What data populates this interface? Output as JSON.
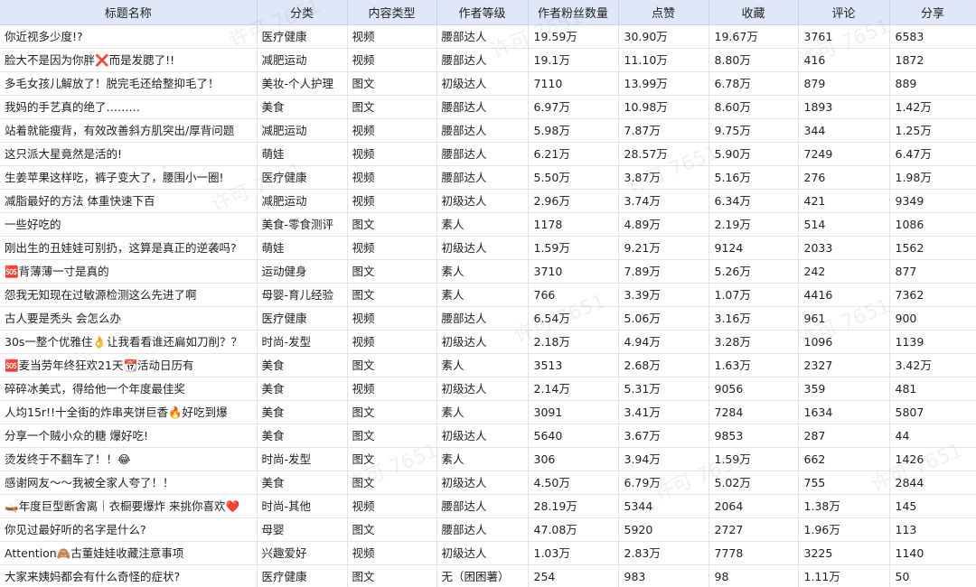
{
  "columns": [
    "标题名称",
    "分类",
    "内容类型",
    "作者等级",
    "作者粉丝数量",
    "点赞",
    "收藏",
    "评论",
    "分享"
  ],
  "rows": [
    [
      "你近视多少度!?",
      "医疗健康",
      "视频",
      "腰部达人",
      "19.59万",
      "30.90万",
      "19.67万",
      "3761",
      "6583"
    ],
    [
      "脸大不是因为你胖❌而是发腮了!!",
      "减肥运动",
      "视频",
      "腰部达人",
      "19.1万",
      "11.10万",
      "8.80万",
      "416",
      "1872"
    ],
    [
      "多毛女孩儿解放了！脱完毛还给整抑毛了！",
      "美妆-个人护理",
      "图文",
      "初级达人",
      "7110",
      "13.99万",
      "6.78万",
      "879",
      "889"
    ],
    [
      "我妈的手艺真的绝了………",
      "美食",
      "图文",
      "腰部达人",
      "6.97万",
      "10.98万",
      "8.60万",
      "1893",
      "1.42万"
    ],
    [
      "站着就能瘦背，有效改善斜方肌突出/厚背问题",
      "减肥运动",
      "视频",
      "腰部达人",
      "5.98万",
      "7.87万",
      "9.75万",
      "344",
      "1.25万"
    ],
    [
      "这只派大星竟然是活的!",
      "萌娃",
      "视频",
      "腰部达人",
      "6.21万",
      "28.57万",
      "5.90万",
      "7249",
      "6.47万"
    ],
    [
      "生姜苹果这样吃，裤子变大了，腰围小一圈!",
      "医疗健康",
      "视频",
      "腰部达人",
      "5.50万",
      "3.87万",
      "5.16万",
      "276",
      "1.98万"
    ],
    [
      "减脂最好的方法 体重快速下百",
      "减肥运动",
      "视频",
      "初级达人",
      "2.96万",
      "3.74万",
      "6.34万",
      "421",
      "9349"
    ],
    [
      "一些好吃的",
      "美食-零食测评",
      "图文",
      "素人",
      "1178",
      "4.89万",
      "2.19万",
      "514",
      "1086"
    ],
    [
      "刚出生的丑娃娃可别扔，这算是真正的逆袭吗?",
      "萌娃",
      "视频",
      "初级达人",
      "1.59万",
      "9.21万",
      "9124",
      "2033",
      "1562"
    ],
    [
      "🆘背薄薄一寸是真的",
      "运动健身",
      "图文",
      "素人",
      "3710",
      "7.89万",
      "5.26万",
      "242",
      "877"
    ],
    [
      "怨我无知现在过敏源检测这么先进了啊",
      "母婴-育儿经验",
      "图文",
      "素人",
      "766",
      "3.39万",
      "1.07万",
      "4416",
      "7362"
    ],
    [
      "古人要是秃头 会怎么办",
      "医疗健康",
      "视频",
      "腰部达人",
      "6.54万",
      "5.06万",
      "3.16万",
      "961",
      "900"
    ],
    [
      "30s一整个优雅住👌让我看看谁还扁如刀削？？",
      "时尚-发型",
      "视频",
      "初级达人",
      "2.18万",
      "4.94万",
      "3.28万",
      "1096",
      "1139"
    ],
    [
      "🆘麦当劳年终狂欢21天📆活动日历有",
      "美食",
      "图文",
      "素人",
      "3513",
      "2.68万",
      "1.63万",
      "2327",
      "3.42万"
    ],
    [
      "碎碎冰美式，得给他一个年度最佳奖",
      "美食",
      "视频",
      "初级达人",
      "2.14万",
      "5.31万",
      "9056",
      "359",
      "481"
    ],
    [
      "人均15r!!十全街的炸串夹饼巨香🔥好吃到爆",
      "美食",
      "图文",
      "素人",
      "3091",
      "3.41万",
      "7284",
      "1634",
      "5807"
    ],
    [
      "分享一个贼小众的糖 爆好吃!",
      "美食",
      "图文",
      "初级达人",
      "5640",
      "3.67万",
      "9853",
      "287",
      "44"
    ],
    [
      "烫发终于不翻车了！！😂",
      "时尚-发型",
      "图文",
      "素人",
      "306",
      "3.94万",
      "1.59万",
      "662",
      "1426"
    ],
    [
      "感谢网友～～我被全家人夸了！！",
      "美食",
      "图文",
      "初级达人",
      "4.50万",
      "6.79万",
      "5.02万",
      "755",
      "2844"
    ],
    [
      "🛶年度巨型断舍离｜衣橱要爆炸 来挑你喜欢❤️",
      "时尚-其他",
      "视频",
      "腰部达人",
      "28.19万",
      "5344",
      "2064",
      "1.38万",
      "145"
    ],
    [
      "你见过最好听的名字是什么?",
      "母婴",
      "图文",
      "腰部达人",
      "47.08万",
      "5920",
      "2727",
      "1.96万",
      "113"
    ],
    [
      "Attention🙈古董娃娃收藏注意事项",
      "兴趣爱好",
      "视频",
      "初级达人",
      "1.03万",
      "2.83万",
      "7778",
      "3225",
      "1140"
    ],
    [
      "大家来姨妈都会有什么奇怪的症状?",
      "医疗健康",
      "图文",
      "无（困困薯）",
      "254",
      "983",
      "98",
      "1.11万",
      "50"
    ]
  ],
  "watermark": "许可 7651"
}
